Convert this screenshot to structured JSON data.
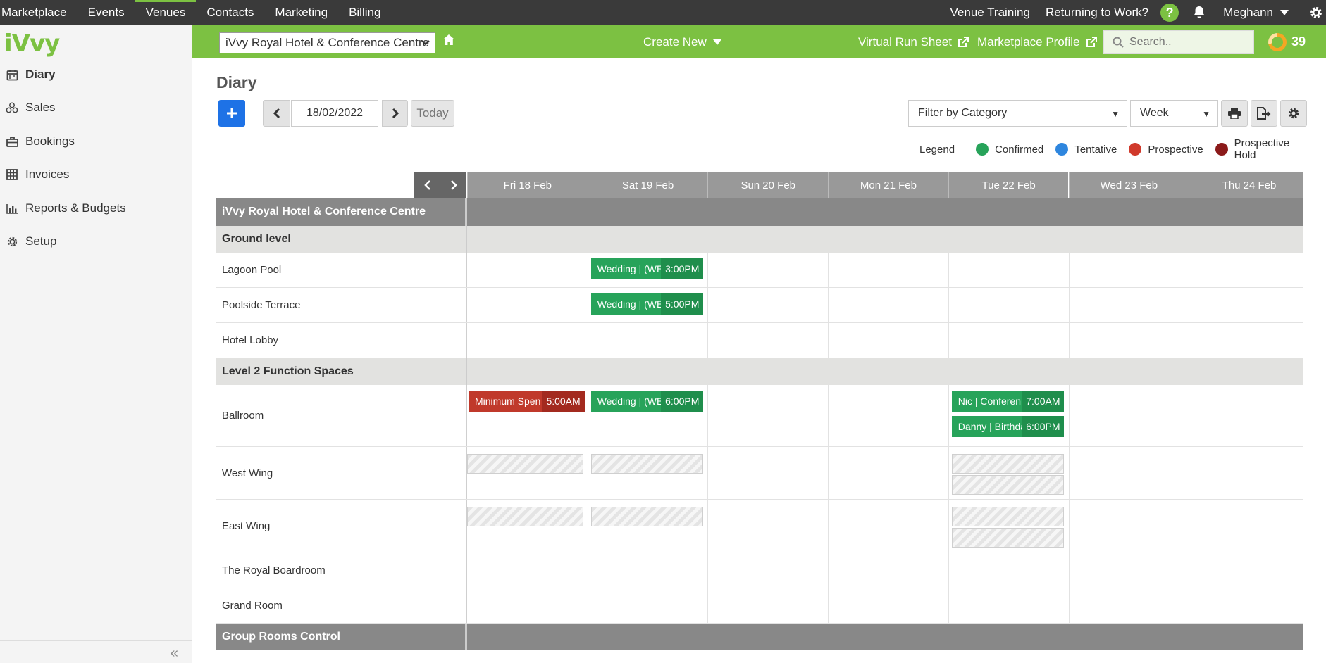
{
  "topnav": {
    "items": [
      "Marketplace",
      "Events",
      "Venues",
      "Contacts",
      "Marketing",
      "Billing"
    ],
    "active": "Venues",
    "venue_training": "Venue Training",
    "returning": "Returning to Work?",
    "help": "?",
    "user": "Meghann"
  },
  "sidebar": {
    "logo": "iVvy",
    "items": [
      {
        "label": "Diary",
        "icon": "calendar-icon",
        "active": true
      },
      {
        "label": "Sales",
        "icon": "sales-icon",
        "active": false
      },
      {
        "label": "Bookings",
        "icon": "briefcase-icon",
        "active": false
      },
      {
        "label": "Invoices",
        "icon": "table-icon",
        "active": false
      },
      {
        "label": "Reports & Budgets",
        "icon": "bar-chart-icon",
        "active": false
      },
      {
        "label": "Setup",
        "icon": "gear-icon",
        "active": false
      }
    ],
    "collapse": "«"
  },
  "header": {
    "venue": "iVvy Royal Hotel & Conference Centre",
    "create_new": "Create New",
    "virtual_run_sheet": "Virtual Run Sheet",
    "marketplace_profile": "Marketplace Profile",
    "search_placeholder": "Search..",
    "count": "39"
  },
  "main": {
    "title": "Diary",
    "date": "18/02/2022",
    "today": "Today",
    "filter": "Filter by Category",
    "view": "Week"
  },
  "legend": {
    "title": "Legend",
    "items": [
      {
        "label": "Confirmed",
        "color": "#27a35a"
      },
      {
        "label": "Tentative",
        "color": "#2e86de"
      },
      {
        "label": "Prospective",
        "color": "#d0392b"
      },
      {
        "label": "Prospective Hold",
        "color": "#8b1a1a"
      }
    ]
  },
  "grid": {
    "days": [
      "Fri 18 Feb",
      "Sat 19 Feb",
      "Sun 20 Feb",
      "Mon 21 Feb",
      "Tue 22 Feb",
      "Wed 23 Feb",
      "Thu 24 Feb"
    ],
    "rows": [
      {
        "type": "venue",
        "label": "iVvy Royal Hotel & Conference Centre"
      },
      {
        "type": "group",
        "label": "Ground level"
      },
      {
        "type": "space",
        "label": "Lagoon Pool"
      },
      {
        "type": "space",
        "label": "Poolside Terrace"
      },
      {
        "type": "space",
        "label": "Hotel Lobby"
      },
      {
        "type": "group",
        "label": "Level 2 Function Spaces"
      },
      {
        "type": "space",
        "label": "Ballroom"
      },
      {
        "type": "space",
        "label": "West Wing"
      },
      {
        "type": "space",
        "label": "East Wing"
      },
      {
        "type": "space",
        "label": "The Royal Boardroom"
      },
      {
        "type": "space",
        "label": "Grand Room"
      },
      {
        "type": "venue",
        "label": "Group Rooms Control"
      }
    ],
    "bookings": [
      {
        "row": 2,
        "day": 1,
        "name": "Wedding | (WE",
        "time": "3:00PM",
        "status": "confirmed"
      },
      {
        "row": 3,
        "day": 1,
        "name": "Wedding | (WE",
        "time": "5:00PM",
        "status": "confirmed"
      },
      {
        "row": 6,
        "day": 0,
        "name": "Minimum Spen",
        "time": "5:00AM",
        "status": "prospective"
      },
      {
        "row": 6,
        "day": 1,
        "name": "Wedding | (WE",
        "time": "6:00PM",
        "status": "confirmed"
      },
      {
        "row": 6,
        "day": 4,
        "name": "Nic | Conferen",
        "time": "7:00AM",
        "status": "confirmed"
      },
      {
        "row": 6,
        "day": 4,
        "name": "Danny | Birthda",
        "time": "6:00PM",
        "status": "confirmed",
        "slot": 1
      }
    ],
    "holds": [
      {
        "row": 7,
        "day": 0
      },
      {
        "row": 7,
        "day": 1
      },
      {
        "row": 7,
        "day": 4
      },
      {
        "row": 7,
        "day": 4,
        "slot": 1
      },
      {
        "row": 8,
        "day": 0
      },
      {
        "row": 8,
        "day": 1
      },
      {
        "row": 8,
        "day": 4
      },
      {
        "row": 8,
        "day": 4,
        "slot": 1
      }
    ]
  }
}
